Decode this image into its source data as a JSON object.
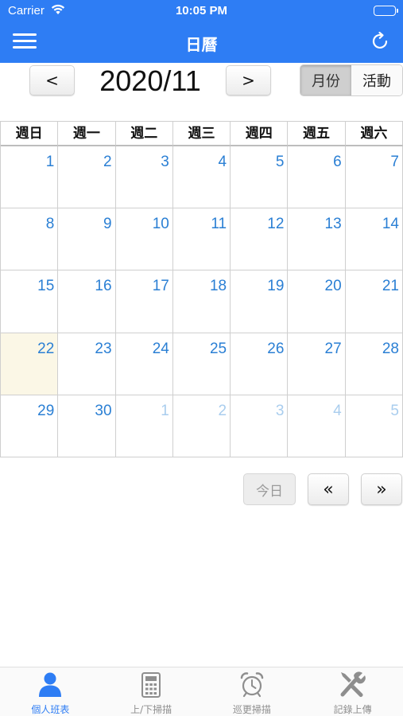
{
  "status_bar": {
    "carrier": "Carrier",
    "time": "10:05 PM"
  },
  "nav": {
    "title": "日曆",
    "menu_icon": "hamburger-menu-icon",
    "refresh_icon": "refresh-icon"
  },
  "month_nav": {
    "prev_label": "<",
    "next_label": ">",
    "month_label": "2020/11"
  },
  "view_toggle": {
    "month_label": "月份",
    "activity_label": "活動",
    "selected": "月份"
  },
  "calendar": {
    "weekdays": [
      "週日",
      "週一",
      "週二",
      "週三",
      "週四",
      "週五",
      "週六"
    ],
    "weeks": [
      [
        "1",
        "2",
        "3",
        "4",
        "5",
        "6",
        "7"
      ],
      [
        "8",
        "9",
        "10",
        "11",
        "12",
        "13",
        "14"
      ],
      [
        "15",
        "16",
        "17",
        "18",
        "19",
        "20",
        "21"
      ],
      [
        "22",
        "23",
        "24",
        "25",
        "26",
        "27",
        "28"
      ],
      [
        "29",
        "30",
        "1",
        "2",
        "3",
        "4",
        "5"
      ]
    ],
    "today": "22",
    "colors": {
      "day": "#2a7fd4",
      "other_month_day": "#a9cdee",
      "today_bg": "#fbf7e6"
    }
  },
  "controls": {
    "today_label": "今日",
    "prev_label": "«",
    "next_label": "»"
  },
  "tabbar": {
    "tabs": [
      {
        "label": "個人班表",
        "icon": "person-icon"
      },
      {
        "label": "上/下掃描",
        "icon": "calculator-icon"
      },
      {
        "label": "巡更掃描",
        "icon": "alarm-clock-icon"
      },
      {
        "label": "記錄上傳",
        "icon": "tools-icon"
      }
    ],
    "active_index": 0
  },
  "colors": {
    "primary": "#2e7df4",
    "inactive_tab": "#8e8e8e"
  }
}
